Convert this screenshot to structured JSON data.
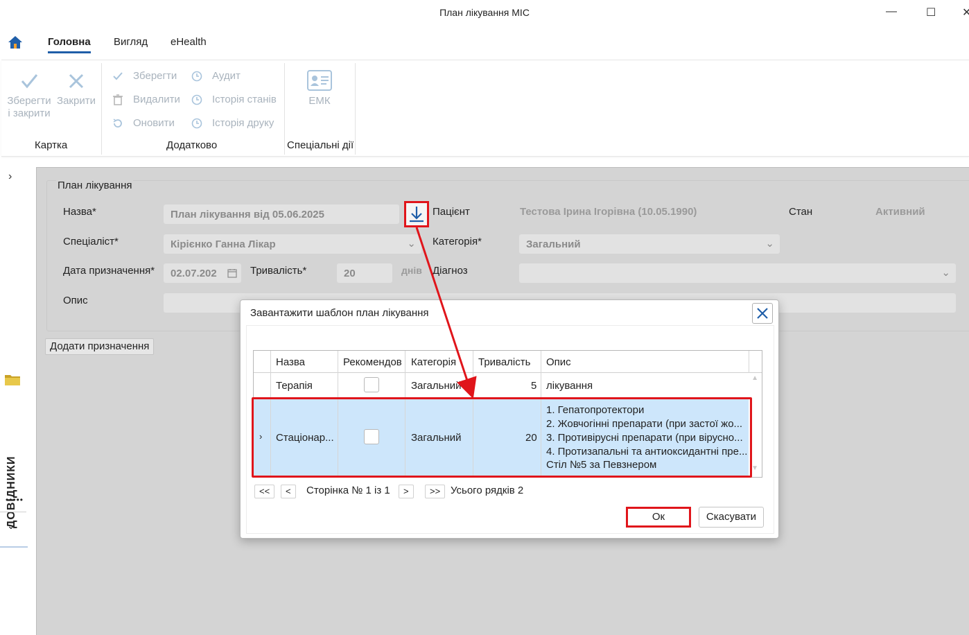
{
  "window": {
    "title": "План лікування МІС"
  },
  "tabs": [
    {
      "label": "Головна",
      "active": true
    },
    {
      "label": "Вигляд"
    },
    {
      "label": "eHealth"
    }
  ],
  "ribbon": {
    "save_close_line1": "Зберегти",
    "save_close_line2": "і закрити",
    "close": "Закрити",
    "save": "Зберегти",
    "delete": "Видалити",
    "refresh": "Оновити",
    "audit": "Аудит",
    "state_history": "Історія станів",
    "print_history": "Історія друку",
    "emk": "ЕМК",
    "group_card": "Картка",
    "group_extra": "Додатково",
    "group_special": "Спеціальні дії"
  },
  "sidebar": {
    "vertical_label": "ДОВІДНИКИ"
  },
  "form": {
    "groupbox_title": "План лікування",
    "name_label": "Назва*",
    "name_value": "План лікування від 05.06.2025",
    "patient_label": "Пацієнт",
    "patient_value": "Тестова Ірина Ігорівна (10.05.1990)",
    "state_label": "Стан",
    "state_value": "Активний",
    "specialist_label": "Спеціаліст*",
    "specialist_value": "Кірієнко Ганна Лікар",
    "category_label": "Категорія*",
    "category_value": "Загальний",
    "date_label": "Дата призначення*",
    "date_value": "02.07.202",
    "duration_label": "Тривалість*",
    "duration_value": "20",
    "duration_unit": "днів",
    "diagnosis_label": "Діагноз",
    "diagnosis_value": "",
    "description_label": "Опис",
    "description_value": "",
    "add_button": "Додати призначення"
  },
  "dialog": {
    "title": "Завантажити шаблон план лікування",
    "columns": [
      "Назва",
      "Рекомендов",
      "Категорія",
      "Тривалість",
      "Опис"
    ],
    "rows": [
      {
        "name": "Терапія",
        "recommended": false,
        "category": "Загальний",
        "duration": "5",
        "description": [
          "лікування"
        ]
      },
      {
        "name": "Стаціонар...",
        "recommended": false,
        "category": "Загальний",
        "duration": "20",
        "selected": true,
        "description": [
          "1. Гепатопротектори",
          "2. Жовчогінні препарати (при застої жо...",
          "3. Противірусні препарати (при вірусно...",
          "4. Протизапальні та антиоксидантні пре...",
          "Стіл №5 за Певзнером"
        ]
      }
    ],
    "pager": {
      "first": "<<",
      "prev": "<",
      "page_text": "Сторінка № 1 із 1",
      "next": ">",
      "last": ">>",
      "total_text": "Усього рядків 2"
    },
    "ok": "Ок",
    "cancel": "Скасувати"
  },
  "colors": {
    "accent": "#1f5ea8",
    "highlight_red": "#e0151b",
    "selected_row": "#cde6fb",
    "workspace_bg": "#d4d4d4"
  }
}
